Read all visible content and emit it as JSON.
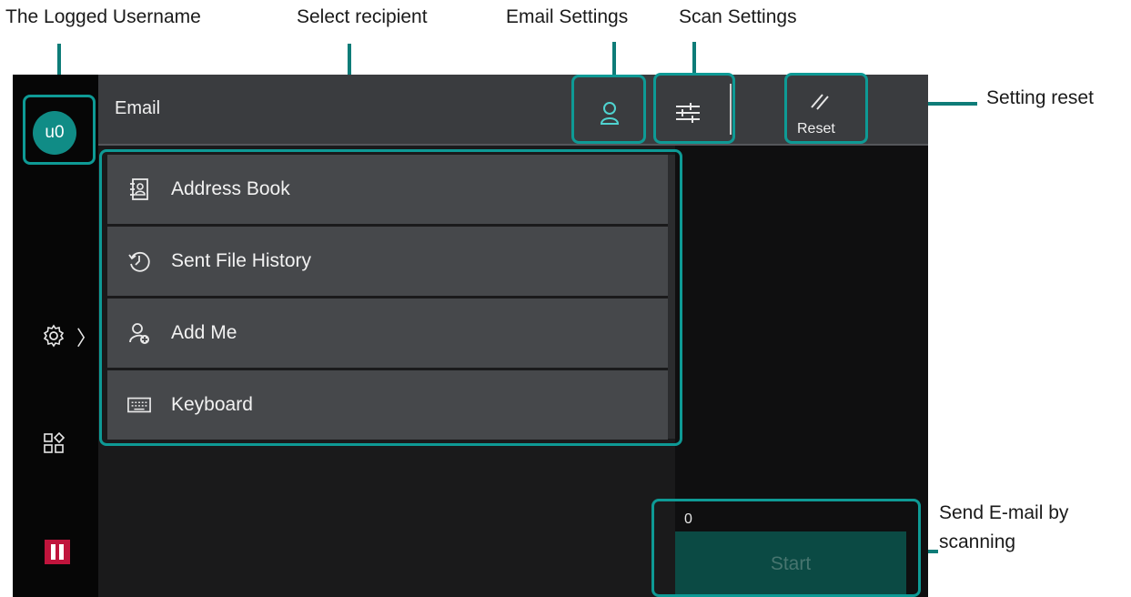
{
  "annotations": {
    "logged_username": "The Logged Username",
    "select_recipient": "Select recipient",
    "email_settings": "Email Settings",
    "scan_settings": "Scan Settings",
    "setting_reset": "Setting reset",
    "send_line1": "Send E-mail by",
    "send_line2": "scanning"
  },
  "header": {
    "title": "Email",
    "reset_label": "Reset"
  },
  "user": {
    "avatar": "u0"
  },
  "menu": {
    "items": [
      {
        "label": "Address Book",
        "icon": "address-book-icon"
      },
      {
        "label": "Sent File History",
        "icon": "history-icon"
      },
      {
        "label": "Add Me",
        "icon": "add-me-icon"
      },
      {
        "label": "Keyboard",
        "icon": "keyboard-icon"
      }
    ]
  },
  "sidebar": {
    "settings_chevron": "〉"
  },
  "footer": {
    "count": "0",
    "start_label": "Start"
  },
  "colors": {
    "accent": "#0e9a95",
    "start_bg": "#0b4a44",
    "stop": "#c0143c"
  }
}
